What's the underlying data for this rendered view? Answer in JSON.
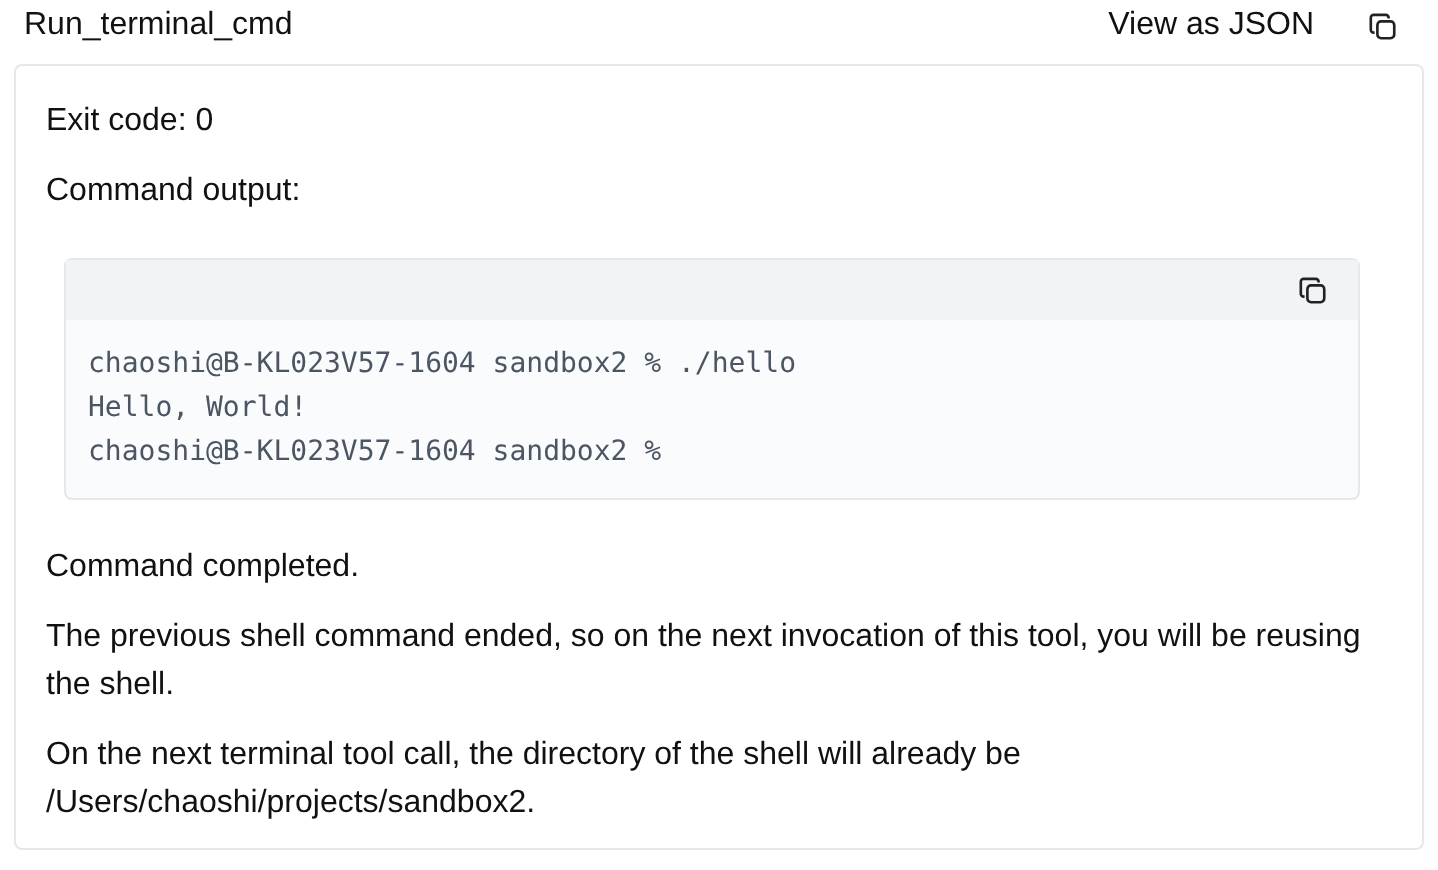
{
  "header": {
    "title": "Run_terminal_cmd",
    "view_json": "View as JSON"
  },
  "result": {
    "exit_code": "Exit code: 0",
    "output_label": "Command output:",
    "code_lines": [
      "chaoshi@B-KL023V57-1604 sandbox2 % ./hello",
      "Hello, World!",
      "chaoshi@B-KL023V57-1604 sandbox2 %"
    ],
    "paragraphs": [
      "Command completed.",
      "The previous shell command ended, so on the next invocation of this tool, you will be reusing the shell.",
      "On the next terminal tool call, the directory of the shell will already be /Users/chaoshi/projects/sandbox2."
    ]
  }
}
